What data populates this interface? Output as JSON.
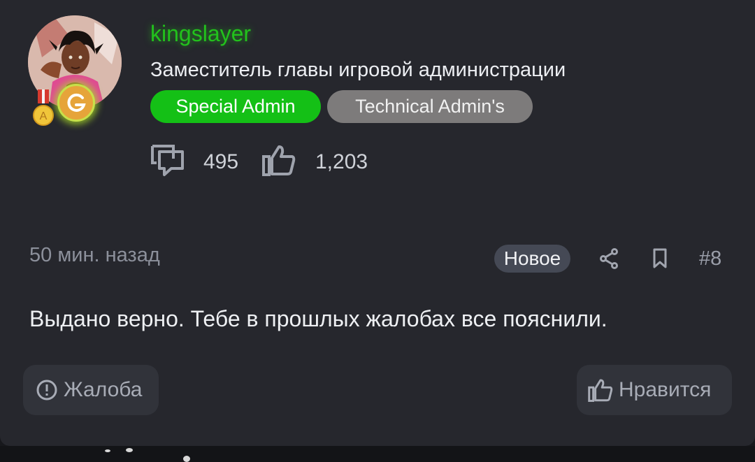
{
  "user": {
    "name": "kingslayer",
    "title": "Заместитель главы игровой администрации",
    "badges": [
      "Special Admin",
      "Technical Admin's"
    ],
    "medal_letter": "A",
    "colors": {
      "name": "#22c21c",
      "badge_special": "#14c016",
      "badge_technical": "#7d7b7b"
    }
  },
  "stats": {
    "messages": "495",
    "reactions": "1,203",
    "messages_icon": "chat-bubbles-icon",
    "reactions_icon": "thumbs-up-icon"
  },
  "post": {
    "time": "50 мин. назад",
    "status": "Новое",
    "number": "#8",
    "body": "Выдано верно. Тебе в прошлых жалобах все пояснили."
  },
  "actions": {
    "report_label": "Жалоба",
    "like_label": "Нравится",
    "share_icon": "share-icon",
    "bookmark_icon": "bookmark-icon"
  }
}
